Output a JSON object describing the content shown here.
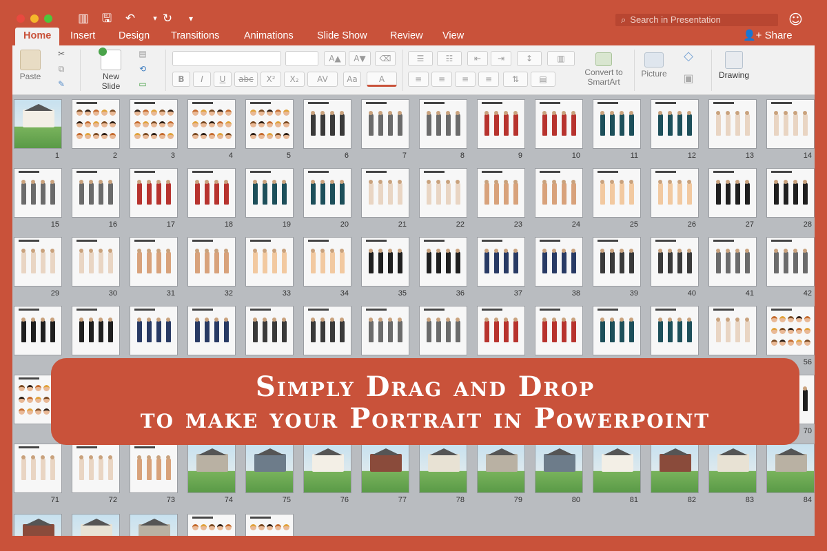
{
  "window": {
    "search_placeholder": "Search in Presentation",
    "icons": [
      "sidebar-icon",
      "save-icon",
      "undo-icon",
      "redo-icon",
      "customize-icon",
      "smiley-icon"
    ]
  },
  "tabs": [
    {
      "label": "Home",
      "active": true
    },
    {
      "label": "Insert"
    },
    {
      "label": "Design"
    },
    {
      "label": "Transitions"
    },
    {
      "label": "Animations"
    },
    {
      "label": "Slide Show"
    },
    {
      "label": "Review"
    },
    {
      "label": "View"
    }
  ],
  "share_label": "Share",
  "ribbon": {
    "paste": "Paste",
    "new_slide_1": "New",
    "new_slide_2": "Slide",
    "convert_1": "Convert to",
    "convert_2": "SmartArt",
    "picture": "Picture",
    "drawing": "Drawing",
    "bold": "B",
    "italic": "I",
    "underline": "U",
    "strike": "abc",
    "superscript": "X²",
    "subscript": "X₂",
    "char_spacing": "AV",
    "grow_font": "A▲",
    "shrink_font": "A▼",
    "font_color": "A"
  },
  "slides": {
    "numbers": [
      "1",
      "2",
      "3",
      "4",
      "5",
      "6",
      "7",
      "8",
      "9",
      "10",
      "11",
      "12",
      "13",
      "14",
      "15",
      "16",
      "17",
      "18",
      "19",
      "20",
      "21",
      "22",
      "23",
      "24",
      "25",
      "26",
      "27",
      "28",
      "29",
      "30",
      "31",
      "32",
      "33",
      "34",
      "35",
      "36",
      "37",
      "38",
      "39",
      "40",
      "41",
      "42",
      "56",
      "70",
      "71",
      "72",
      "73",
      "74",
      "75",
      "76",
      "77",
      "78",
      "79",
      "80",
      "81",
      "82",
      "83",
      "84"
    ]
  },
  "banner": {
    "line1": "Simply Drag and Drop",
    "line2": "to make your Portrait in Powerpoint"
  },
  "colors": {
    "accent": "#c9523a",
    "ribbon": "#f1f1f1",
    "sorter": "#b9bcc0"
  }
}
